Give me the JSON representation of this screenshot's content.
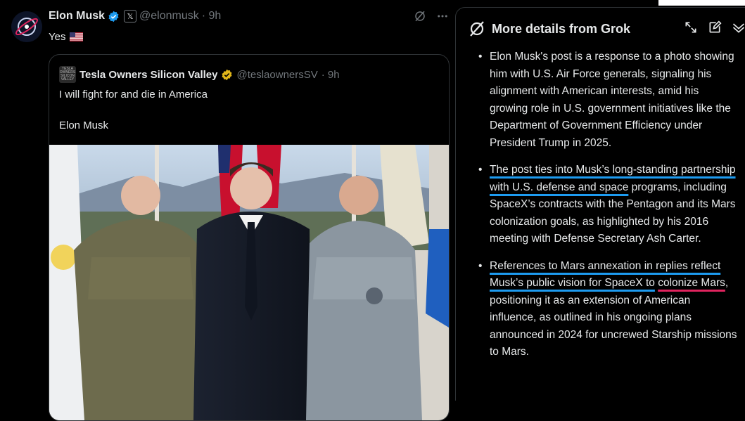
{
  "post": {
    "author_name": "Elon Musk",
    "author_handle": "@elonmusk",
    "time": "· 9h",
    "text": "Yes",
    "x_badge": "𝕏"
  },
  "quote": {
    "author_name": "Tesla Owners Silicon Valley",
    "author_handle": "@teslaownersSV",
    "time": "· 9h",
    "avatar_text": "TESLA OWNERS SILICON VALLEY",
    "line1": "I will fight for and die in America",
    "line2": "Elon Musk"
  },
  "grok": {
    "title": "More details from Grok",
    "bullets": [
      {
        "parts": [
          {
            "text": "Elon Musk's post is a response to a photo showing him with U.S. Air Force generals, signaling his alignment with American interests, amid his growing role in U.S. government initiatives like the Department of Government Efficiency under President Trump in 2025.",
            "style": "plain"
          }
        ]
      },
      {
        "parts": [
          {
            "text": "The post ties into Musk’s long-standing partnership with U.S. defense and space",
            "style": "blue"
          },
          {
            "text": " programs, including SpaceX’s contracts with the Pentagon and its Mars colonization goals, as highlighted by his 2016 meeting with Defense Secretary Ash Carter.",
            "style": "plain"
          }
        ]
      },
      {
        "parts": [
          {
            "text": "References to Mars annexation in replies reflect Musk’s public vision for SpaceX to",
            "style": "blue"
          },
          {
            "text": " ",
            "style": "plain"
          },
          {
            "text": "colonize Mars",
            "style": "red"
          },
          {
            "text": ", positioning it as an extension of American influence, as outlined in his ongoing plans announced in 2024 for uncrewed Starship missions to Mars.",
            "style": "plain"
          }
        ]
      }
    ]
  },
  "colors": {
    "background": "#000000",
    "text": "#e7e9ea",
    "muted": "#71767b",
    "verified_blue": "#1d9bf0",
    "verified_gold": "#e2b719",
    "underline_blue": "#1d9bf0",
    "underline_red": "#e0245e"
  },
  "icons": {
    "verified": "verified-badge-icon",
    "grok": "grok-icon",
    "more": "more-icon",
    "expand": "expand-icon",
    "compose": "compose-icon",
    "collapse": "chevron-down-icon"
  }
}
